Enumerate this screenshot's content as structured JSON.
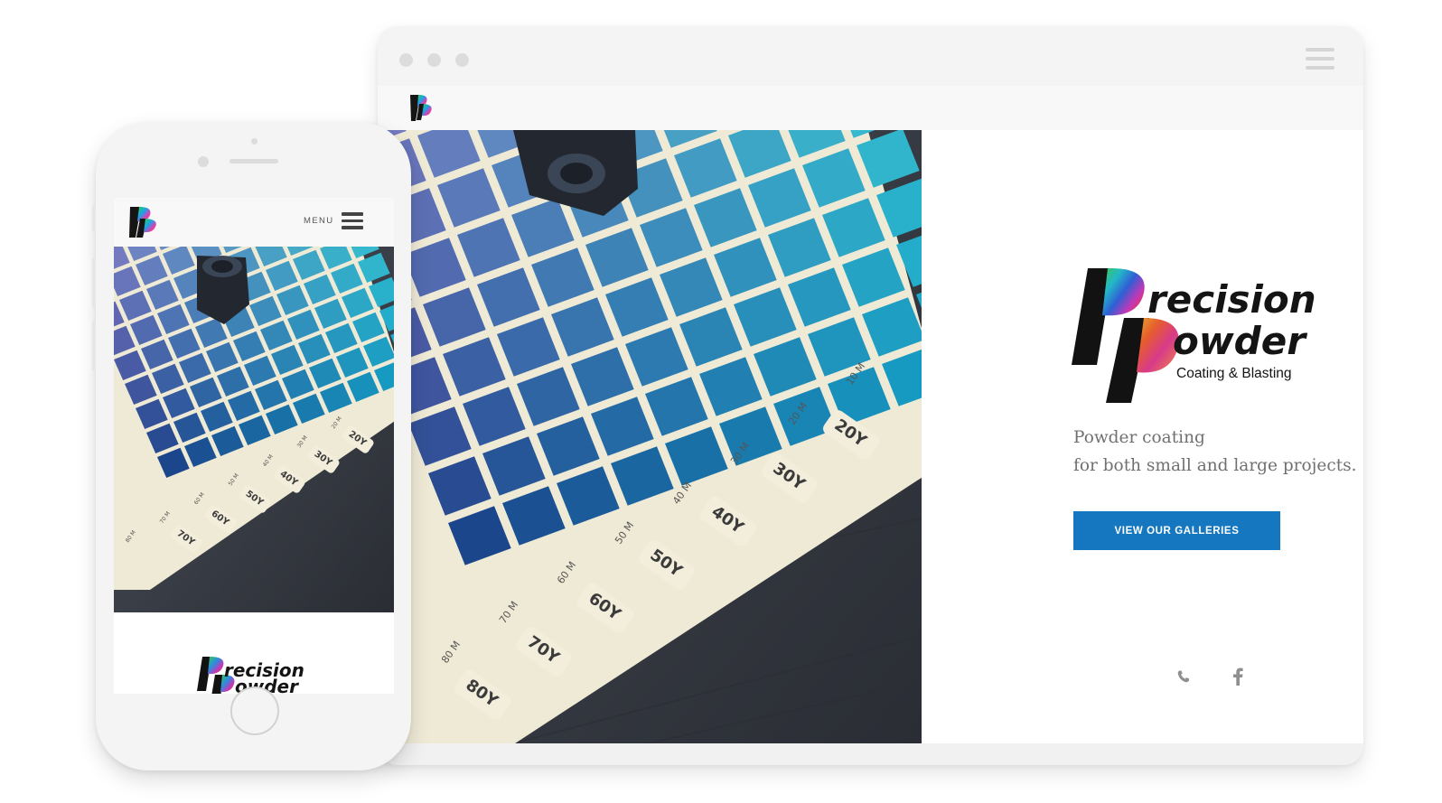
{
  "desktop": {
    "logo_alt": "PP",
    "brand": {
      "line1": "recision",
      "line2": "owder",
      "line3": "Coating & Blasting"
    },
    "tagline": {
      "line1": "Powder coating",
      "line2": "for both small and large projects."
    },
    "cta_label": "VIEW OUR GALLERIES",
    "social": [
      {
        "name": "phone-icon"
      },
      {
        "name": "facebook-icon"
      }
    ],
    "colors": {
      "accent": "#1577c0",
      "swatch_teal": "#1fb6c6",
      "wood": "#3c4048"
    }
  },
  "mobile": {
    "menu_label": "MENU",
    "brand": {
      "line1": "recision",
      "line2": "owder"
    }
  },
  "photo_labels": {
    "tabs": [
      "20Y",
      "30Y",
      "40Y",
      "50Y",
      "60Y",
      "70Y",
      "80Y"
    ],
    "m_marks": [
      "10",
      "20",
      "30",
      "40",
      "50",
      "60",
      "70",
      "80"
    ],
    "m_suffix": "M"
  }
}
